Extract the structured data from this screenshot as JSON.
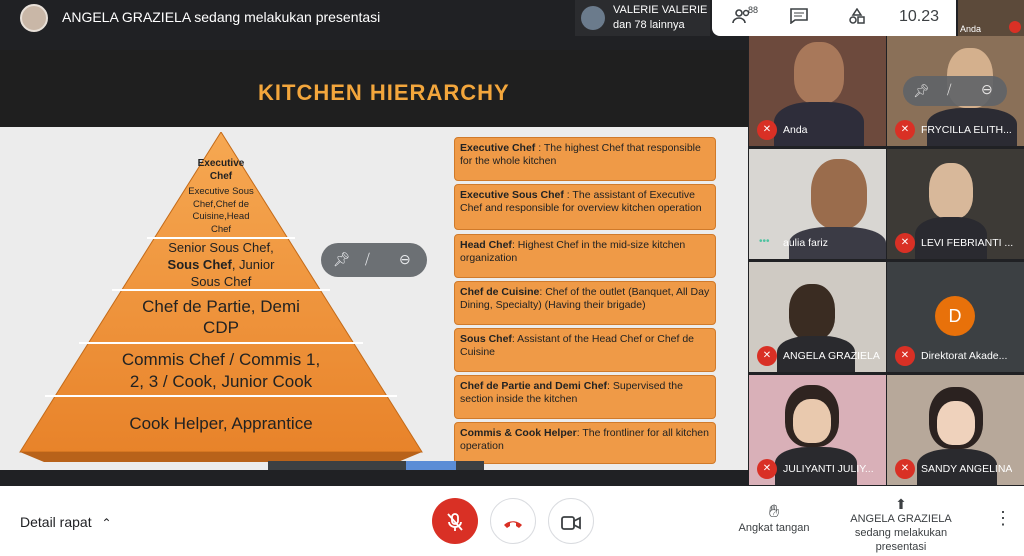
{
  "topbar": {
    "presenting_text": "ANGELA GRAZIELA sedang melakukan presentasi",
    "people_line1": "VALERIE VALERIE",
    "people_line2": "dan 78 lainnya",
    "participants_count": "88",
    "clock": "10.23",
    "self_label": "Anda",
    "icons": [
      "people-icon",
      "chat-icon",
      "activities-icon"
    ]
  },
  "slide": {
    "title": "KITCHEN HIERARCHY",
    "pyramid": [
      {
        "line1": "Executive",
        "line2": "Chef"
      },
      {
        "line1": "Executive Sous",
        "line2": "Chef,Chef de",
        "line3": "Cuisine,Head",
        "line4": "Chef"
      },
      {
        "line1": "Senior Sous Chef,",
        "line2a": "Sous Chef",
        "line2b": ", Junior",
        "line3": "Sous Chef"
      },
      {
        "line1": "Chef de Partie, Demi",
        "line2": "CDP"
      },
      {
        "line1": "Commis Chef / Commis 1,",
        "line2": "2, 3 / Cook, Junior Cook"
      },
      {
        "line1": "Cook Helper, Apprantice"
      }
    ],
    "cards": [
      {
        "term": "Executive Chef",
        "desc": " : The highest Chef that responsible for the whole kitchen"
      },
      {
        "term": "Executive Sous Chef",
        "desc": " : The assistant of Executive Chef and responsible for overview kitchen operation"
      },
      {
        "term": "Head Chef",
        "desc": ": Highest Chef in the mid-size kitchen organization"
      },
      {
        "term": "Chef de Cuisine",
        "desc": ": Chef of the outlet (Banquet, All Day Dining, Specialty) (Having their brigade)"
      },
      {
        "term": "Sous Chef",
        "desc": ": Assistant of the Head Chef or Chef de Cuisine"
      },
      {
        "term": "Chef de Partie and Demi Chef",
        "desc": ": Supervised the section inside the kitchen"
      },
      {
        "term": "Commis & Cook Helper",
        "desc": ": The frontliner for all kitchen operation"
      }
    ]
  },
  "tiles": [
    {
      "name": "Anda",
      "muted": true
    },
    {
      "name": "FRYCILLA ELITH...",
      "muted": true
    },
    {
      "name": "aulia fariz",
      "muted": false
    },
    {
      "name": "LEVI FEBRIANTI ...",
      "muted": true
    },
    {
      "name": "ANGELA GRAZIELA",
      "muted": true
    },
    {
      "name": "Direktorat Akade...",
      "muted": true,
      "initial": "D"
    },
    {
      "name": "JULIYANTI JULIY...",
      "muted": true
    },
    {
      "name": "SANDY ANGELINA",
      "muted": true
    }
  ],
  "bottombar": {
    "details_label": "Detail rapat",
    "raise_hand_label": "Angkat tangan",
    "present_line1": "ANGELA GRAZIELA",
    "present_line2": "sedang melakukan presentasi"
  },
  "colors": {
    "accent_orange": "#ef9a47",
    "title_orange": "#f3a63c",
    "mute_red": "#d93025",
    "avatar_orange": "#e8710a"
  }
}
